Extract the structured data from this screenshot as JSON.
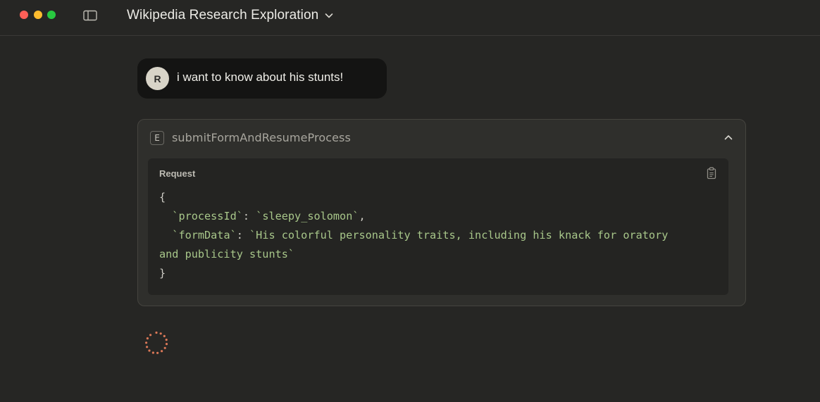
{
  "window": {
    "title": "Wikipedia Research Exploration"
  },
  "user_message": {
    "avatar_initial": "R",
    "text": "i want to know about his stunts!"
  },
  "tool_call": {
    "badge": "E",
    "name": "submitFormAndResumeProcess",
    "request_label": "Request",
    "code": {
      "open": "{",
      "process_key": "`processId`",
      "process_value": "`sleepy_solomon`",
      "form_key": "`formData`",
      "form_value_line1": "`His colorful personality traits, including his knack for oratory",
      "form_value_line2": "and publicity stunts`",
      "close": "}"
    }
  },
  "colors": {
    "background": "#262624",
    "code_string": "#a8c78a",
    "spinner": "#d97757"
  },
  "icons": {
    "sidebar_toggle": "sidebar-icon",
    "title_menu": "chevron-down-icon",
    "collapse": "chevron-up-icon",
    "copy": "clipboard-icon",
    "loading": "spinner-icon"
  }
}
